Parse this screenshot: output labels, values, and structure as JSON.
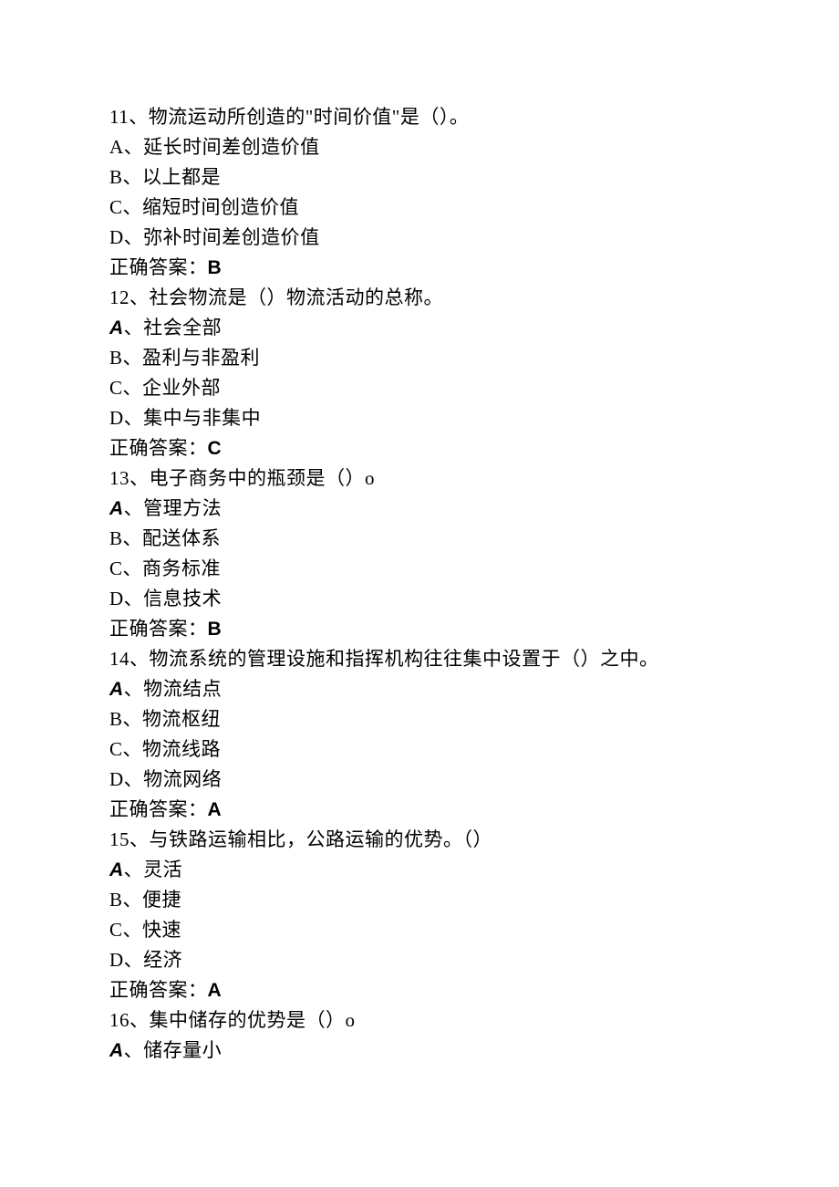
{
  "questions": [
    {
      "number": "11",
      "text": "、物流运动所创造的\"时间价值\"是（）。",
      "options": [
        {
          "letter": "A",
          "text": "、延长时间差创造价值",
          "styledA": false
        },
        {
          "letter": "B",
          "text": "、以上都是",
          "styledA": false
        },
        {
          "letter": "C",
          "text": "、缩短时间创造价值",
          "styledA": false
        },
        {
          "letter": "D",
          "text": "、弥补时间差创造价值",
          "styledA": false
        }
      ],
      "answerLabel": "正确答案：",
      "answerValue": "B"
    },
    {
      "number": "12",
      "text": "、社会物流是（）物流活动的总称。",
      "options": [
        {
          "letter": "A",
          "text": "、社会全部",
          "styledA": true
        },
        {
          "letter": "B",
          "text": "、盈利与非盈利",
          "styledA": false
        },
        {
          "letter": "C",
          "text": "、企业外部",
          "styledA": false
        },
        {
          "letter": "D",
          "text": "、集中与非集中",
          "styledA": false
        }
      ],
      "answerLabel": "正确答案：",
      "answerValue": "C"
    },
    {
      "number": "13",
      "text": "、电子商务中的瓶颈是（）o",
      "options": [
        {
          "letter": "A",
          "text": "、管理方法",
          "styledA": true
        },
        {
          "letter": "B",
          "text": "、配送体系",
          "styledA": false
        },
        {
          "letter": "C",
          "text": "、商务标准",
          "styledA": false
        },
        {
          "letter": "D",
          "text": "、信息技术",
          "styledA": false
        }
      ],
      "answerLabel": "正确答案：",
      "answerValue": "B"
    },
    {
      "number": "14",
      "text": "、物流系统的管理设施和指挥机构往往集中设置于（）之中。",
      "options": [
        {
          "letter": "A",
          "text": "、物流结点",
          "styledA": true
        },
        {
          "letter": "B",
          "text": "、物流枢纽",
          "styledA": false
        },
        {
          "letter": "C",
          "text": "、物流线路",
          "styledA": false
        },
        {
          "letter": "D",
          "text": "、物流网络",
          "styledA": false
        }
      ],
      "answerLabel": "正确答案：",
      "answerValue": "A"
    },
    {
      "number": "15",
      "text": "、与铁路运输相比，公路运输的优势。（）",
      "options": [
        {
          "letter": "A",
          "text": "、灵活",
          "styledA": true
        },
        {
          "letter": "B",
          "text": "、便捷",
          "styledA": false
        },
        {
          "letter": "C",
          "text": "、快速",
          "styledA": false
        },
        {
          "letter": "D",
          "text": "、经济",
          "styledA": false
        }
      ],
      "answerLabel": "正确答案：",
      "answerValue": "A"
    },
    {
      "number": "16",
      "text": "、集中储存的优势是（）o",
      "options": [
        {
          "letter": "A",
          "text": "、储存量小",
          "styledA": true
        }
      ],
      "answerLabel": "",
      "answerValue": ""
    }
  ]
}
